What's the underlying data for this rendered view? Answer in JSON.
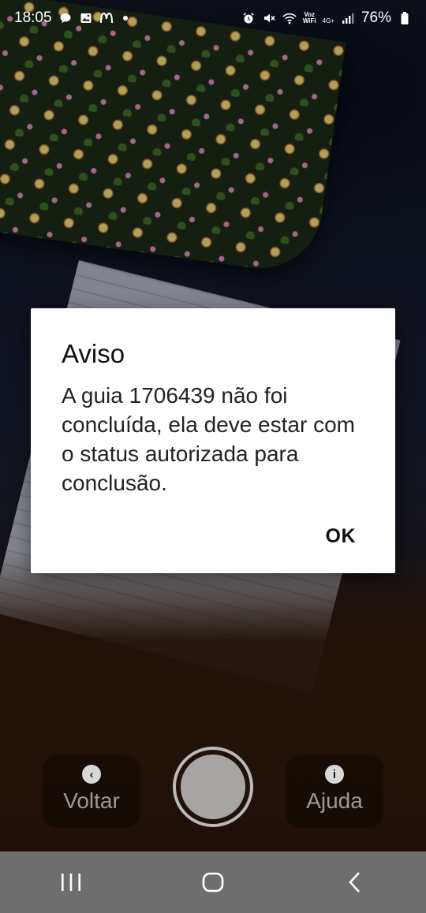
{
  "status_bar": {
    "time": "18:05",
    "left_icons": [
      "chat-icon",
      "gallery-icon",
      "mcdonalds-icon"
    ],
    "voz_wifi_line1": "Voz",
    "voz_wifi_line2": "WiFi",
    "network": "4G+",
    "battery": "76%"
  },
  "dialog": {
    "title": "Aviso",
    "message": "A guia 1706439 não foi concluída, ela deve estar com o status autorizada para conclusão.",
    "ok_label": "OK"
  },
  "camera_controls": {
    "back_label": "Voltar",
    "help_label": "Ajuda",
    "back_icon": "chevron-left-icon",
    "help_icon": "info-icon",
    "shutter_icon": "shutter-button"
  },
  "nav_bar": {
    "recents_icon": "recents-icon",
    "home_icon": "home-icon",
    "back_icon": "back-icon"
  },
  "colors": {
    "dialog_bg": "#ffffff",
    "nav_bar_bg": "#6e6e6e",
    "text_dark": "#111111"
  }
}
